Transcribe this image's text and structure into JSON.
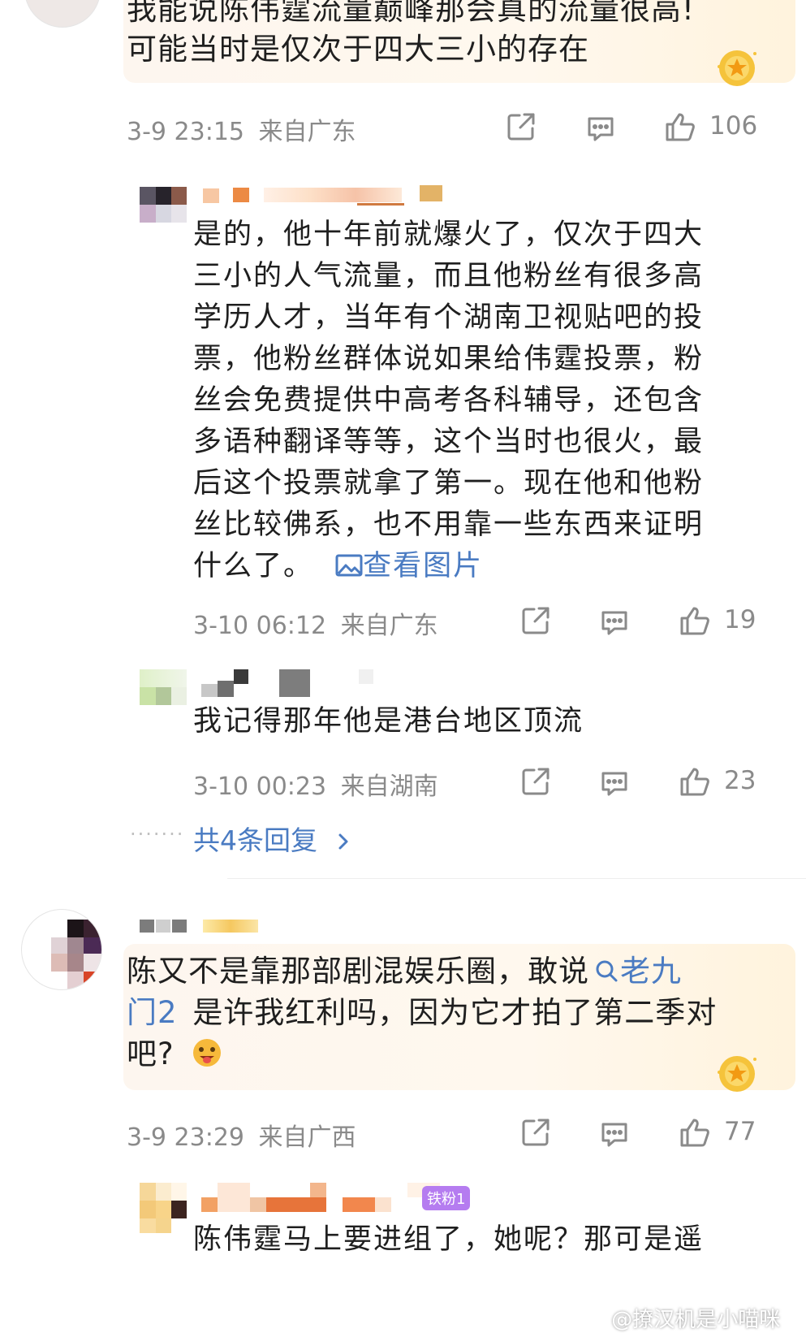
{
  "comments": [
    {
      "text_lines": [
        "我能说陈伟霆流量巅峰那会真的流量很高!",
        "可能当时是仅次于四大三小的存在"
      ],
      "time": "3-9 23:15",
      "location": "来自广东",
      "likes": "106"
    },
    {
      "text_lines": [
        "陈又不是靠那部剧混娱乐圈，敢说",
        "是许我红利吗，因为它才拍了第二季对",
        "吧?"
      ],
      "hashtag_part1": "老九",
      "hashtag_part2": "门2",
      "time": "3-9 23:29",
      "location": "来自广西",
      "likes": "77"
    }
  ],
  "replies": [
    {
      "text_lines": [
        "是的，他十年前就爆火了，仅次于四大",
        "三小的人气流量，而且他粉丝有很多高",
        "学历人才，当年有个湖南卫视贴吧的投",
        "票，他粉丝群体说如果给伟霆投票，粉",
        "丝会免费提供中高考各科辅导，还包含",
        "多语种翻译等等，这个当时也很火，最",
        "后这个投票就拿了第一。现在他和他粉",
        "丝比较佛系，也不用靠一些东西来证明",
        "什么了。"
      ],
      "view_image": "查看图片",
      "time": "3-10 06:12",
      "location": "来自广东",
      "likes": "19"
    },
    {
      "text_lines": [
        "我记得那年他是港台地区顶流"
      ],
      "time": "3-10 00:23",
      "location": "来自湖南",
      "likes": "23"
    },
    {
      "text_lines": [
        "陈伟霆马上要进组了，她呢？那可是遥"
      ],
      "fan_badge": "铁粉1"
    }
  ],
  "more_replies": "共4条回复",
  "watermark": "@撩汉机是小喵咪",
  "colors": {
    "link": "#4a7bc2",
    "meta": "#8a8a8a",
    "bubble": "#fdf6ef"
  },
  "icons": [
    "share-icon",
    "comment-icon",
    "like-icon",
    "image-icon",
    "search-icon",
    "chevron-right-icon",
    "gold-badge-icon",
    "weibo-icon"
  ]
}
